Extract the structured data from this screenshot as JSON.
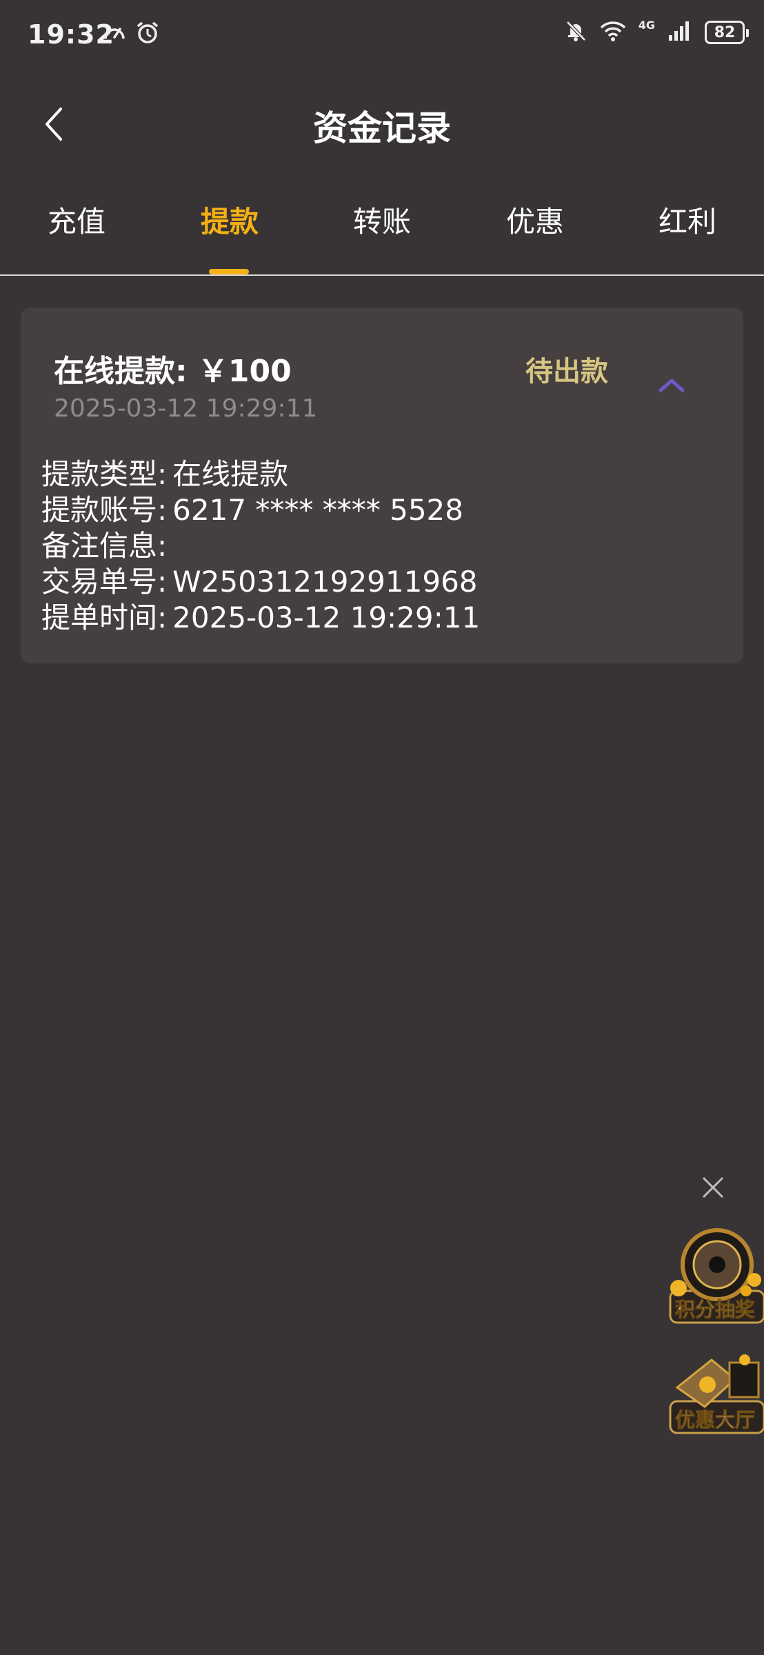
{
  "status_bar": {
    "time": "19:32",
    "network": "4G",
    "battery": "82",
    "icons": [
      "speedometer-icon",
      "alarm-icon",
      "mute-bell-icon",
      "wifi-icon",
      "signal-icon",
      "battery-icon"
    ]
  },
  "header": {
    "title": "资金记录",
    "back_icon": "chevron-left-icon"
  },
  "tabs": [
    {
      "label": "充值",
      "active": false
    },
    {
      "label": "提款",
      "active": true
    },
    {
      "label": "转账",
      "active": false
    },
    {
      "label": "优惠",
      "active": false
    },
    {
      "label": "红利",
      "active": false
    }
  ],
  "record": {
    "title": "在线提款: ￥100",
    "time": "2025-03-12 19:29:11",
    "status": "待出款",
    "toggle_icon": "chevron-up-icon",
    "details": [
      {
        "label": "提款类型:",
        "value": "在线提款"
      },
      {
        "label": "提款账号:",
        "value": "6217 **** **** 5528"
      },
      {
        "label": "备注信息:",
        "value": ""
      },
      {
        "label": "交易单号:",
        "value": "W250312192911968"
      },
      {
        "label": "提单时间:",
        "value": "2025-03-12 19:29:11"
      }
    ]
  },
  "floating": {
    "close_icon": "close-icon",
    "lottery_label": "积分抽奖",
    "promo_label": "优惠大厅"
  },
  "colors": {
    "background": "#383435",
    "card": "#453f40",
    "accent": "#f5b014",
    "status": "#d7c583",
    "chevron": "#6a5acd",
    "muted_text": "#8f8a8b"
  }
}
